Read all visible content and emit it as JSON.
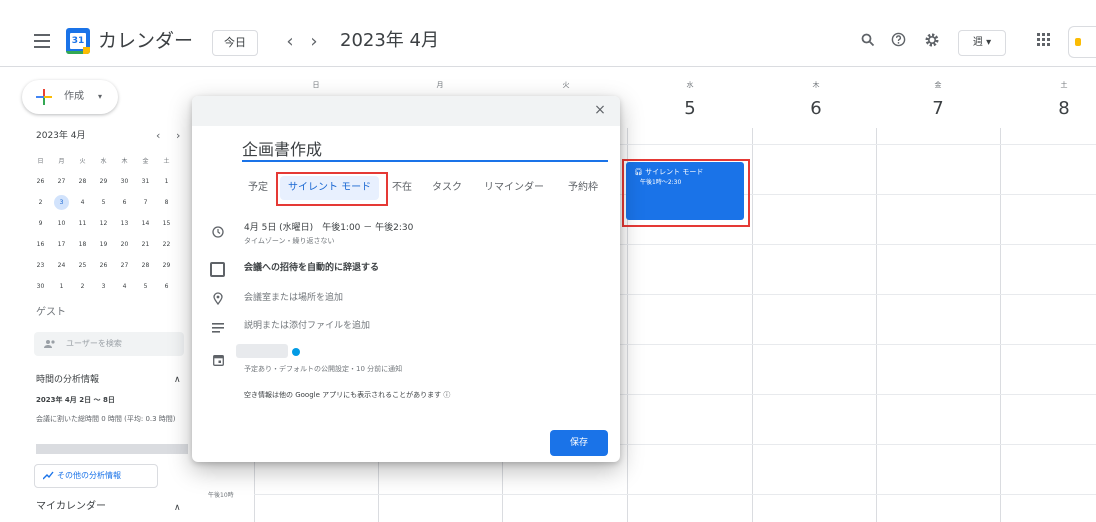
{
  "app": {
    "title": "カレンダー",
    "logo_day": "31"
  },
  "header": {
    "today": "今日",
    "prev": "‹",
    "next": "›",
    "month": "2023年 4月",
    "view": "週 ▾"
  },
  "sidebar": {
    "create": "作成",
    "create_caret": "▾",
    "mini_title": "2023年 4月",
    "mini_prev": "‹",
    "mini_next": "›",
    "weekdays": [
      "日",
      "月",
      "火",
      "水",
      "木",
      "金",
      "土"
    ],
    "weeks": [
      [
        "26",
        "27",
        "28",
        "29",
        "30",
        "31",
        "1"
      ],
      [
        "2",
        "3",
        "4",
        "5",
        "6",
        "7",
        "8"
      ],
      [
        "9",
        "10",
        "11",
        "12",
        "13",
        "14",
        "15"
      ],
      [
        "16",
        "17",
        "18",
        "19",
        "20",
        "21",
        "22"
      ],
      [
        "23",
        "24",
        "25",
        "26",
        "27",
        "28",
        "29"
      ],
      [
        "30",
        "1",
        "2",
        "3",
        "4",
        "5",
        "6"
      ]
    ],
    "guest_label": "ゲスト",
    "guest_placeholder": "ユーザーを検索",
    "insights_title": "時間の分析情報",
    "insights_range": "2023年 4月 2日 ～ 8日",
    "insights_text": "会議に割いた総時間 0 時間 (平均: 0.3 時間)",
    "more_insights": "その他の分析情報",
    "my_calendars": "マイカレンダー"
  },
  "week": {
    "days": [
      {
        "dow": "日",
        "num": ""
      },
      {
        "dow": "月",
        "num": ""
      },
      {
        "dow": "火",
        "num": ""
      },
      {
        "dow": "水",
        "num": "5"
      },
      {
        "dow": "木",
        "num": "6"
      },
      {
        "dow": "金",
        "num": "7"
      },
      {
        "dow": "土",
        "num": "8"
      }
    ],
    "time_label": "午後10時"
  },
  "event": {
    "title": "サイレント モード",
    "time": "午後1時～2:30"
  },
  "dialog": {
    "close": "×",
    "title": "企画書作成",
    "tabs": [
      "予定",
      "サイレント モード",
      "不在",
      "タスク",
      "リマインダー",
      "予約枠"
    ],
    "datetime": "4月 5日 (水曜日)　午後1:00 － 午後2:30",
    "timezone": "タイムゾーン・繰り返さない",
    "decline": "会議への招待を自動的に辞退する",
    "location": "会議室または場所を追加",
    "description": "説明または添付ファイルを追加",
    "cal_sub": "予定あり・デフォルトの公開設定・10 分前に通知",
    "free_busy": "空き情報は他の Google アプリにも表示されることがあります ⓘ",
    "save": "保存"
  },
  "colors": {
    "accent": "#1a73e8",
    "highlight": "#e53935"
  }
}
